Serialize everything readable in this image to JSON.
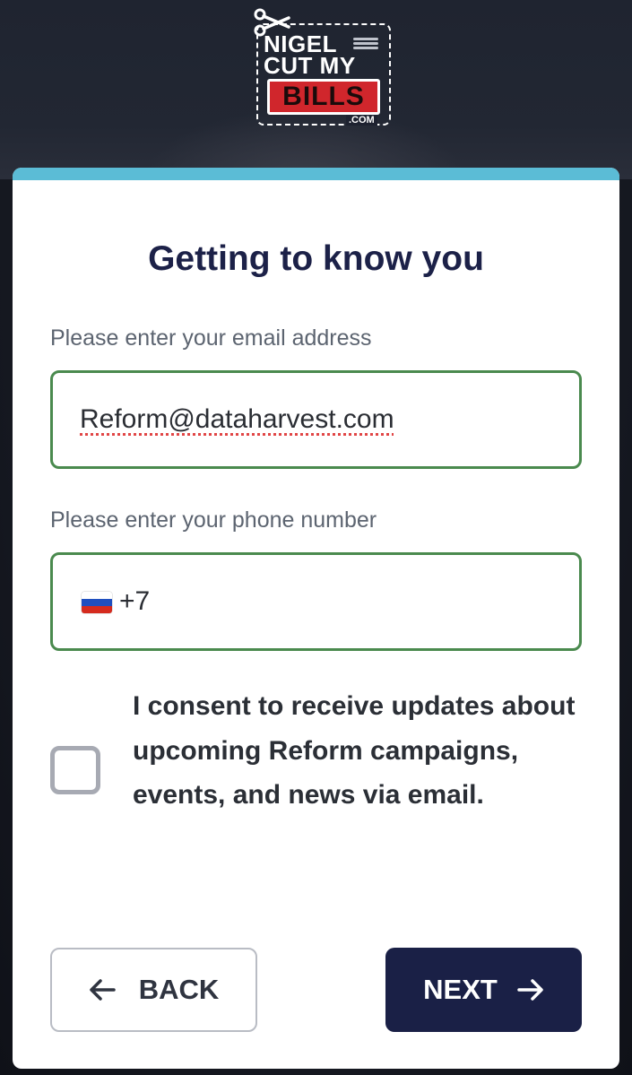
{
  "logo": {
    "line1": "NIGEL",
    "line2": "CUT MY",
    "line3": "BILLS",
    "domain_suffix": ".COM",
    "icon": "scissors-icon",
    "colors": {
      "accent": "#d0262c"
    }
  },
  "form": {
    "title": "Getting to know you",
    "email": {
      "label": "Please enter your email address",
      "value": "Reform@dataharvest.com"
    },
    "phone": {
      "label": "Please enter your phone number",
      "flag_icon": "russia-flag-icon",
      "country_code": "+7"
    },
    "consent": {
      "checked": false,
      "text": "I consent to receive updates about upcoming Reform campaigns, events, and news via email."
    },
    "buttons": {
      "back": {
        "label": "BACK",
        "icon": "arrow-left-icon"
      },
      "next": {
        "label": "NEXT",
        "icon": "arrow-right-icon"
      }
    }
  },
  "colors": {
    "card_top_bar": "#5bbcd6",
    "title": "#1c2148",
    "input_border_valid": "#4a8a4e",
    "next_button_bg": "#1a2046"
  }
}
